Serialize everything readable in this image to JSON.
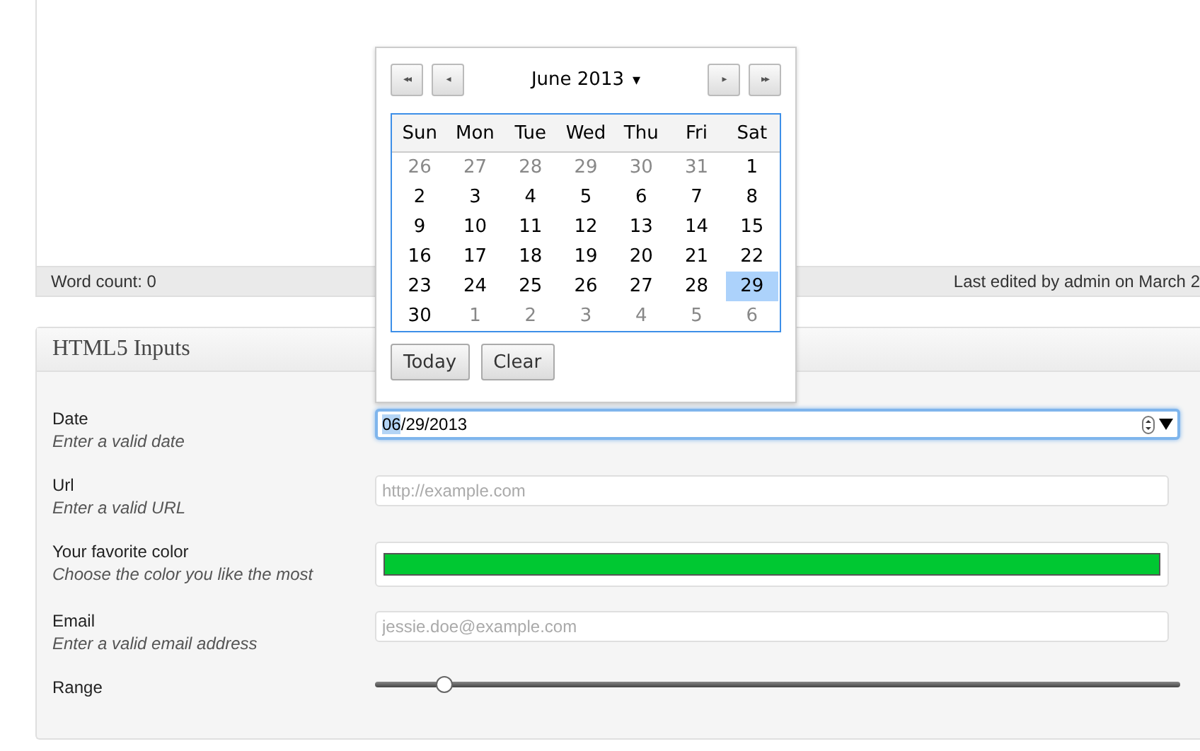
{
  "status_bar": {
    "word_count": "Word count: 0",
    "last_edited": "Last edited by admin on March 2"
  },
  "panel": {
    "title": "HTML5 Inputs"
  },
  "fields": [
    {
      "kind": "date",
      "label": "Date",
      "hint": "Enter a valid date",
      "value": "06/29/2013",
      "focused": true,
      "first_segment_selected": true
    },
    {
      "kind": "url",
      "label": "Url",
      "hint": "Enter a valid URL",
      "placeholder": "http://example.com"
    },
    {
      "kind": "color",
      "label": "Your favorite color",
      "hint": "Choose the color you like the most",
      "color": "#00c832"
    },
    {
      "kind": "email",
      "label": "Email",
      "hint": "Enter a valid email address",
      "placeholder": "jessie.doe@example.com"
    },
    {
      "kind": "range",
      "label": "Range",
      "level": 0.086
    }
  ],
  "datepicker": {
    "nav": {
      "first": "◂◂",
      "prev": "◂",
      "next": "▸",
      "last": "▸▸"
    },
    "month": "June 2013",
    "month_caret": "▾",
    "weekdays": [
      "Sun",
      "Mon",
      "Tue",
      "Wed",
      "Thu",
      "Fri",
      "Sat"
    ],
    "days": [
      {
        "day": "26",
        "outside": true,
        "selected": false
      },
      {
        "day": "27",
        "outside": true,
        "selected": false
      },
      {
        "day": "28",
        "outside": true,
        "selected": false
      },
      {
        "day": "29",
        "outside": true,
        "selected": false
      },
      {
        "day": "30",
        "outside": true,
        "selected": false
      },
      {
        "day": "31",
        "outside": true,
        "selected": false
      },
      {
        "day": "1",
        "outside": false,
        "selected": false
      },
      {
        "day": "2",
        "outside": false,
        "selected": false
      },
      {
        "day": "3",
        "outside": false,
        "selected": false
      },
      {
        "day": "4",
        "outside": false,
        "selected": false
      },
      {
        "day": "5",
        "outside": false,
        "selected": false
      },
      {
        "day": "6",
        "outside": false,
        "selected": false
      },
      {
        "day": "7",
        "outside": false,
        "selected": false
      },
      {
        "day": "8",
        "outside": false,
        "selected": false
      },
      {
        "day": "9",
        "outside": false,
        "selected": false
      },
      {
        "day": "10",
        "outside": false,
        "selected": false
      },
      {
        "day": "11",
        "outside": false,
        "selected": false
      },
      {
        "day": "12",
        "outside": false,
        "selected": false
      },
      {
        "day": "13",
        "outside": false,
        "selected": false
      },
      {
        "day": "14",
        "outside": false,
        "selected": false
      },
      {
        "day": "15",
        "outside": false,
        "selected": false
      },
      {
        "day": "16",
        "outside": false,
        "selected": false
      },
      {
        "day": "17",
        "outside": false,
        "selected": false
      },
      {
        "day": "18",
        "outside": false,
        "selected": false
      },
      {
        "day": "19",
        "outside": false,
        "selected": false
      },
      {
        "day": "20",
        "outside": false,
        "selected": false
      },
      {
        "day": "21",
        "outside": false,
        "selected": false
      },
      {
        "day": "22",
        "outside": false,
        "selected": false
      },
      {
        "day": "23",
        "outside": false,
        "selected": false
      },
      {
        "day": "24",
        "outside": false,
        "selected": false
      },
      {
        "day": "25",
        "outside": false,
        "selected": false
      },
      {
        "day": "26",
        "outside": false,
        "selected": false
      },
      {
        "day": "27",
        "outside": false,
        "selected": false
      },
      {
        "day": "28",
        "outside": false,
        "selected": false
      },
      {
        "day": "29",
        "outside": false,
        "selected": true
      },
      {
        "day": "30",
        "outside": false,
        "selected": false
      },
      {
        "day": "1",
        "outside": true,
        "selected": false
      },
      {
        "day": "2",
        "outside": true,
        "selected": false
      },
      {
        "day": "3",
        "outside": true,
        "selected": false
      },
      {
        "day": "4",
        "outside": true,
        "selected": false
      },
      {
        "day": "5",
        "outside": true,
        "selected": false
      },
      {
        "day": "6",
        "outside": true,
        "selected": false
      }
    ],
    "buttons": [
      "Today",
      "Clear"
    ]
  }
}
